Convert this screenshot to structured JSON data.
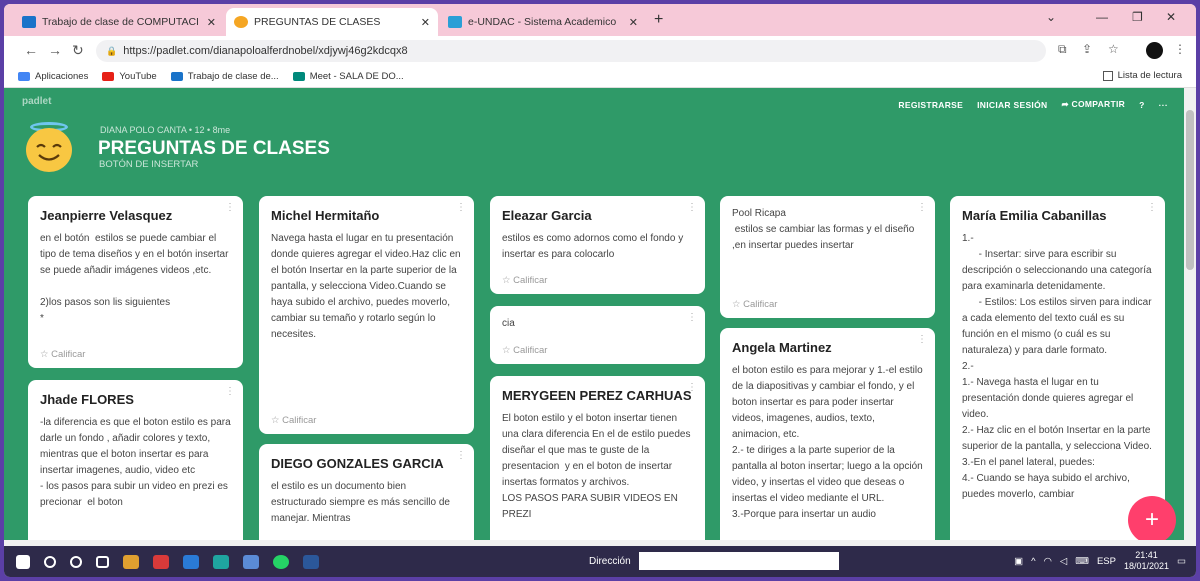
{
  "browser": {
    "tabs": [
      {
        "label": "Trabajo de clase de COMPUTACI",
        "active": false
      },
      {
        "label": "PREGUNTAS DE CLASES",
        "active": true
      },
      {
        "label": "e-UNDAC - Sistema Academico",
        "active": false
      }
    ],
    "url": "https://padlet.com/dianapoloalferdnobel/xdjywj46g2kdcqx8",
    "bookmarks": [
      "Aplicaciones",
      "YouTube",
      "Trabajo de clase de...",
      "Meet - SALA DE DO..."
    ],
    "reading_list": "Lista de lectura"
  },
  "padlet": {
    "brand": "padlet",
    "actions": {
      "register": "REGISTRARSE",
      "login": "INICIAR SESIÓN",
      "share": "COMPARTIR"
    },
    "meta": "DIANA POLO CANTA • 12 • 8me",
    "title": "PREGUNTAS DE CLASES",
    "subtitle": "BOTÓN DE INSERTAR",
    "rate_label": "Calificar",
    "colors": {
      "background": "#2f9a68",
      "fab": "#ff3f6c"
    }
  },
  "cards": {
    "c1": {
      "title": "Jeanpierre Velasquez",
      "body": "en el botón  estilos se puede cambiar el tipo de tema diseños y en el botón insertar se puede añadir imágenes videos ,etc.\n\n2)los pasos son lis siguientes\n*"
    },
    "c2": {
      "title": "Jhade FLORES",
      "body": "-la diferencia es que el boton estilo es para darle un fondo , añadir colores y texto, mientras que el boton insertar es para insertar imagenes, audio, video etc\n- los pasos para subir un video en prezi es precionar  el boton"
    },
    "c3": {
      "title": "Michel Hermitaño",
      "body": "Navega hasta el lugar en tu presentación donde quieres agregar el video.Haz clic en el botón Insertar en la parte superior de la pantalla, y selecciona Video.Cuando se haya subido el archivo, puedes moverlo, cambiar su temaño y rotarlo según lo necesites."
    },
    "c4": {
      "title": "DIEGO GONZALES GARCIA",
      "body": "el estilo es un documento bien estructurado siempre es más sencillo de manejar. Mientras"
    },
    "c5": {
      "title": "Eleazar Garcia",
      "body": "estilos es como adornos como el fondo y insertar es para colocarlo"
    },
    "c6": {
      "body": "cia"
    },
    "c7": {
      "title": "MERYGEEN PEREZ CARHUAS",
      "body": "El boton estilo y el boton insertar tienen una clara diferencia En el de estilo puedes diseñar el que mas te guste de la presentacion  y en el boton de insertar insertas formatos y archivos.\nLOS PASOS PARA SUBIR VIDEOS EN PREZI"
    },
    "c8": {
      "author": "Pool Ricapa",
      "body": " estilos se cambiar las formas y el diseño ,en insertar puedes insertar"
    },
    "c9": {
      "title": "Angela Martinez",
      "body": "el boton estilo es para mejorar y 1.-el estilo de la diapositivas y cambiar el fondo, y el boton insertar es para poder insertar videos, imagenes, audios, texto, animacion, etc.\n2.- te diriges a la parte superior de la pantalla al boton insertar; luego a la opción video, y insertas el video que deseas o insertas el video mediante el URL.\n3.-Porque para insertar un audio"
    },
    "c10": {
      "title": "María Emilia Cabanillas",
      "body": "1.-\n      - Insertar: sirve para escribir su descripción o seleccionando una categoría para examinarla detenidamente.\n      - Estilos: Los estilos sirven para indicar a cada elemento del texto cuál es su función en el mismo (o cuál es su naturaleza) y para darle formato.\n2.-\n1.- Navega hasta el lugar en tu presentación donde quieres agregar el video.\n2.- Haz clic en el botón Insertar en la parte superior de la pantalla, y selecciona Video.\n3.-En el panel lateral, puedes:\n4.- Cuando se haya subido el archivo, puedes moverlo, cambiar"
    }
  },
  "taskbar": {
    "address_label": "Dirección",
    "lang": "ESP",
    "time": "21:41",
    "date": "18/01/2021"
  }
}
